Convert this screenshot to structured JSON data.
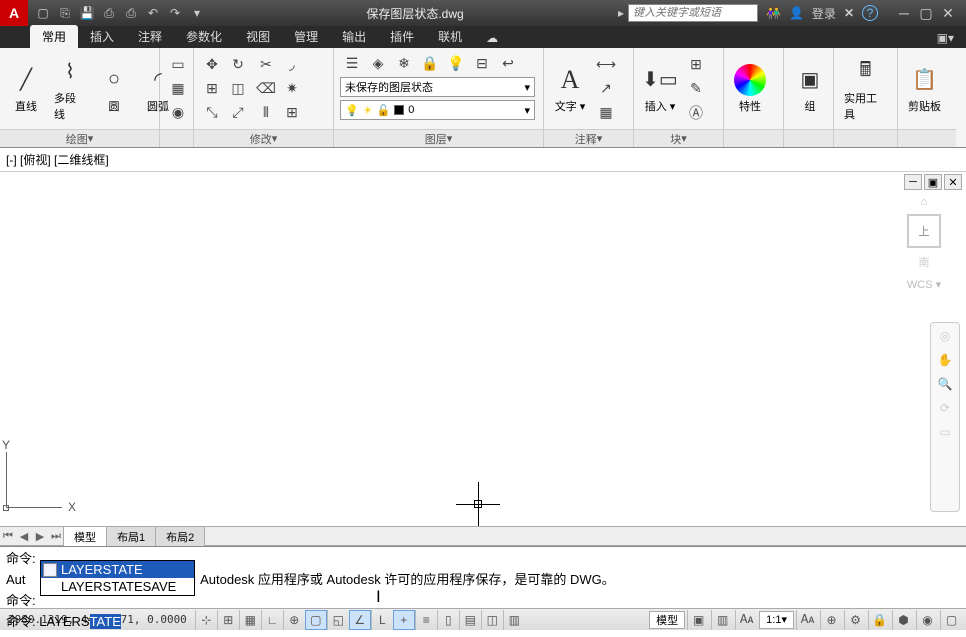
{
  "title": "保存图层状态.dwg",
  "search_placeholder": "键入关键字或短语",
  "login_text": "登录",
  "qat_icons": [
    "new",
    "open",
    "save",
    "saveas",
    "print",
    "undo",
    "redo"
  ],
  "ribbon_tabs": [
    "常用",
    "插入",
    "注释",
    "参数化",
    "视图",
    "管理",
    "输出",
    "插件",
    "联机"
  ],
  "active_tab": 0,
  "panels": {
    "draw": {
      "label": "绘图",
      "items": [
        "直线",
        "多段线",
        "圆",
        "圆弧"
      ]
    },
    "modify": {
      "label": "修改"
    },
    "layer": {
      "label": "图层",
      "state_combo": "未保存的图层状态",
      "current": "0"
    },
    "annot": {
      "label": "注释",
      "text_btn": "文字"
    },
    "block": {
      "label": "块",
      "insert_btn": "插入"
    },
    "props": {
      "label": "特性"
    },
    "group": {
      "label": "组"
    },
    "util": {
      "label": "实用工具"
    },
    "clip": {
      "label": "剪贴板"
    }
  },
  "view_label": "[-] [俯视] [二维线框]",
  "viewcube": {
    "face": "上",
    "wcs": "WCS"
  },
  "model_tabs": [
    "模型",
    "布局1",
    "布局2"
  ],
  "command": {
    "line1": "命令:",
    "line2_prefix": "Aut",
    "line2_rest": "件上次由 Autodesk 应用程序或 Autodesk 许可的应用程序保存，是可靠的 DWG。",
    "line3": "命令:",
    "prompt": "命令: ",
    "typed_prefix": "LAYERS",
    "typed_hl": "TATE",
    "autocomplete": [
      "LAYERSTATE",
      "LAYERSTATESAVE"
    ],
    "ac_selected": 0
  },
  "status": {
    "coords": "2980.1319, 443.9671, 0.0000",
    "model_chip": "模型",
    "scale": "1:1"
  }
}
